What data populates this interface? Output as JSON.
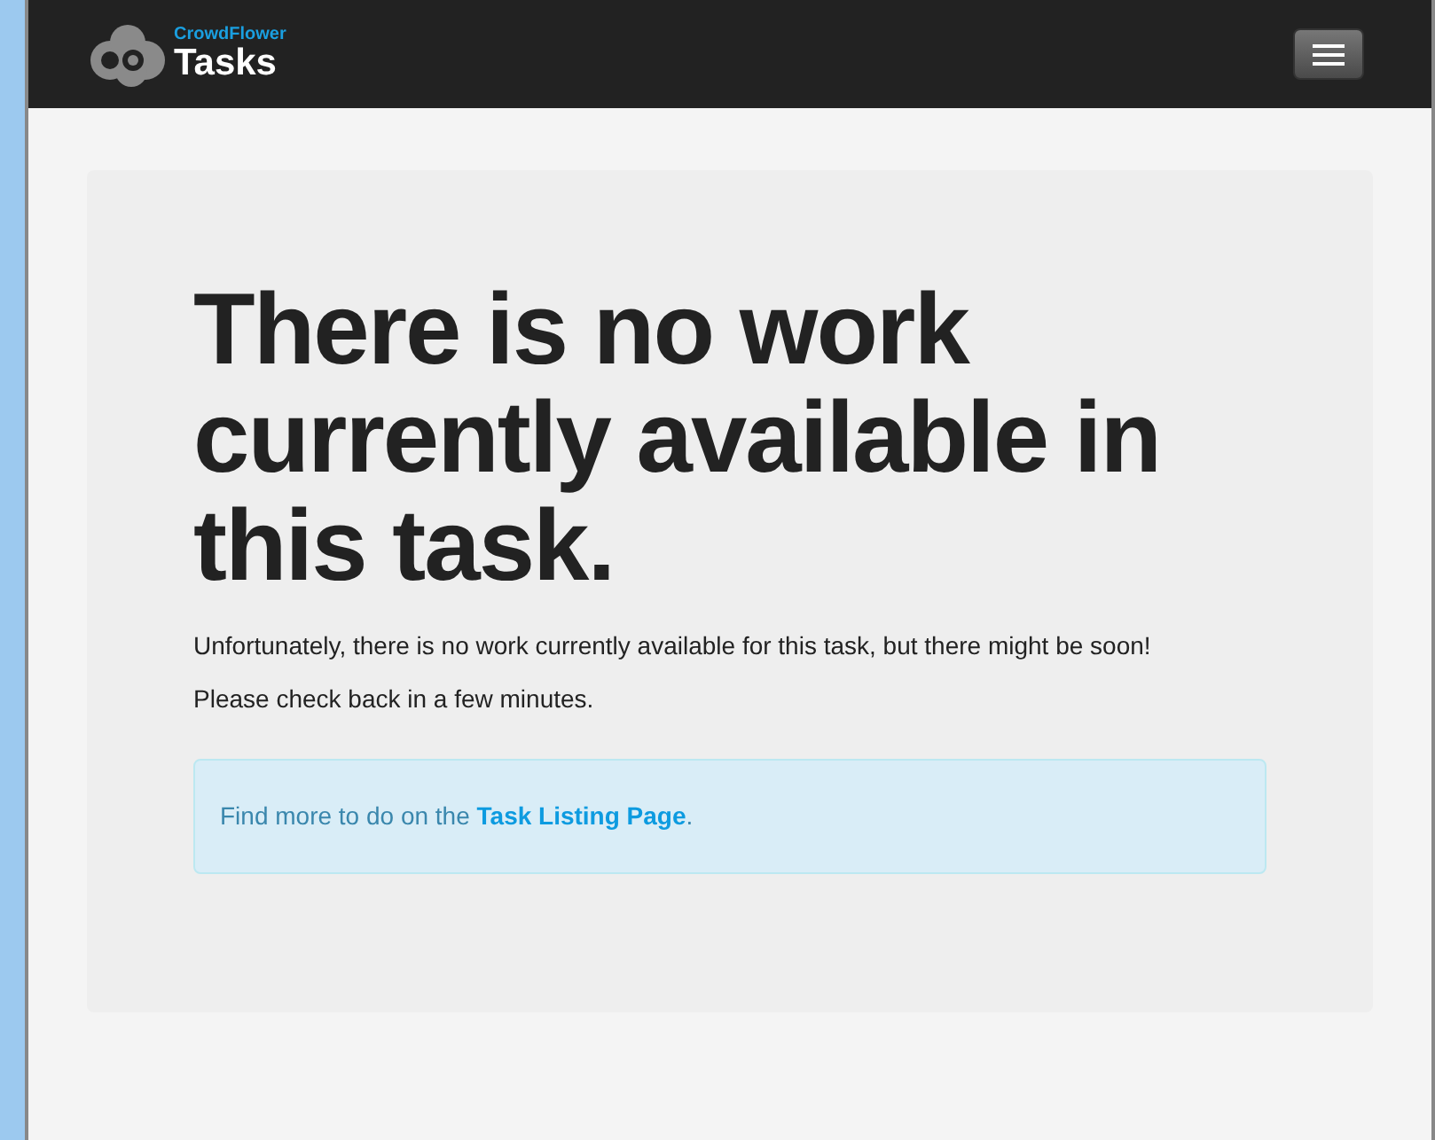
{
  "navbar": {
    "brand_small": "CrowdFlower",
    "brand_title": "Tasks"
  },
  "heading": "There is no work currently available in this task.",
  "paragraphs": [
    "Unfortunately, there is no work currently available for this task, but there might be soon!",
    "Please check back in a few minutes."
  ],
  "alert": {
    "before": "Find more to do on the ",
    "link": "Task Listing Page",
    "after": "."
  }
}
